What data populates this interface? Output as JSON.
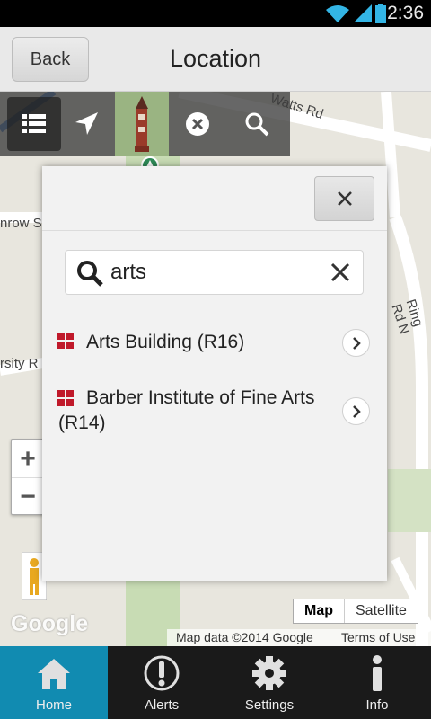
{
  "status_bar": {
    "time": "2:36",
    "icons": [
      "wifi-icon",
      "signal-icon",
      "battery-icon"
    ]
  },
  "header": {
    "back_label": "Back",
    "title": "Location"
  },
  "map": {
    "toolbar_icons": [
      "list-icon",
      "navigation-arrow-icon",
      "landmark-tower-icon",
      "clear-icon",
      "search-icon"
    ],
    "zoom_in": "+",
    "zoom_out": "−",
    "street_labels": [
      "Watts Rd",
      "nrow S",
      "rsity R",
      "Ring Rd N"
    ],
    "provider_logo": "Google",
    "map_types": [
      "Map",
      "Satellite"
    ],
    "selected_map_type": "Map",
    "credit": "Map data ©2014 Google",
    "terms": "Terms of Use"
  },
  "dialog": {
    "search_value": "arts",
    "results": [
      {
        "label": "Arts Building (R16)"
      },
      {
        "label": "Barber Institute of Fine Arts (R14)"
      }
    ]
  },
  "bottom_nav": [
    {
      "label": "Home",
      "icon": "home-icon",
      "active": true
    },
    {
      "label": "Alerts",
      "icon": "alert-icon",
      "active": false
    },
    {
      "label": "Settings",
      "icon": "gear-icon",
      "active": false
    },
    {
      "label": "Info",
      "icon": "info-icon",
      "active": false
    }
  ],
  "colors": {
    "accent": "#118bb1",
    "result_icon": "#c0192a",
    "map_bg": "#e6e4dc"
  }
}
